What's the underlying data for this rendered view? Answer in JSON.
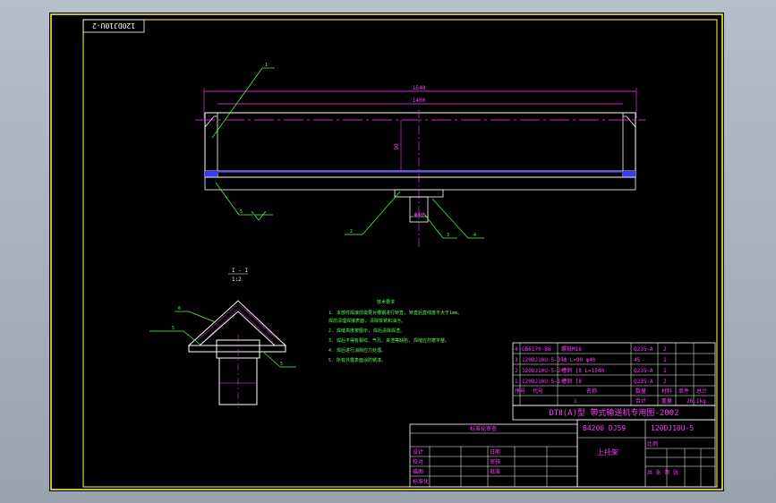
{
  "drawing_number_tag": "120DJ10U-2",
  "part_callouts": [
    "1",
    "2",
    "3",
    "4",
    "5"
  ],
  "section_label": "I - I",
  "section_scale": "1:2",
  "section_callouts": [
    "6",
    "5",
    "5"
  ],
  "dimension_labels": {
    "overall_width": "1540",
    "inner_width": "1400",
    "height": "90",
    "shaft_dia": "Φ40"
  },
  "notes_title": "技术要求",
  "notes": [
    "1. 本部件焊接前需要对槽钢进行矫直, 矫直后直线度不大于1mm。",
    "   焊前清理焊接表面, 清除铁锈和油污。",
    "2. 焊缝高度按图示, 焊后清除焊渣。",
    "3. 焊后不得有裂纹、气孔、夹渣等缺陷, 焊缝应打磨平整。",
    "4. 焊后进行消除应力处理。",
    "5. 所有外露表面涂防锈漆。"
  ],
  "bom_rows": [
    [
      "4",
      "GB6170-86",
      "",
      "螺母M16",
      "2",
      "Q235-A",
      "",
      "",
      ""
    ],
    [
      "3",
      "120DJ10U-5-3",
      "",
      "轴 L=90 φ40",
      "1",
      "45",
      "",
      "",
      ""
    ],
    [
      "2",
      "120DJ10U-5-2",
      "",
      "槽钢 [8 L=1540",
      "1",
      "Q235-A",
      "",
      "",
      ""
    ],
    [
      "1",
      "120DJ10U-5-1",
      "",
      "槽钢 [8",
      "2",
      "Q235-A",
      "",
      "",
      ""
    ]
  ],
  "bom_header": [
    "序号",
    "代号",
    "名称",
    "数量",
    "材料",
    "单件",
    "总计",
    "备注"
  ],
  "bom_header_extra": [
    "1",
    "合计",
    "重量",
    "26.1kg"
  ],
  "title_block": {
    "series_title": "DTⅡ(A)型 带式输送机专用图-2002",
    "standard_code": "B4200 DJ59",
    "drawing_code": "120DJ10U-5",
    "part_name": "上托架",
    "scale_label": "比例",
    "sheet_label": "共 张 第 张"
  },
  "revision_block_title": "标准化审查",
  "revision_rows": [
    [
      "设计",
      "",
      "日期",
      ""
    ],
    [
      "校对",
      "",
      "审核",
      ""
    ],
    [
      "描图",
      "",
      "批准",
      ""
    ],
    [
      "标准化",
      "",
      "",
      ""
    ]
  ],
  "colors": {
    "background": "#000000",
    "frame": "#ffff55",
    "outline": "#ffffff",
    "dimension": "#ff3cff",
    "leader": "#59ff59",
    "hidden": "#3a3aff"
  }
}
